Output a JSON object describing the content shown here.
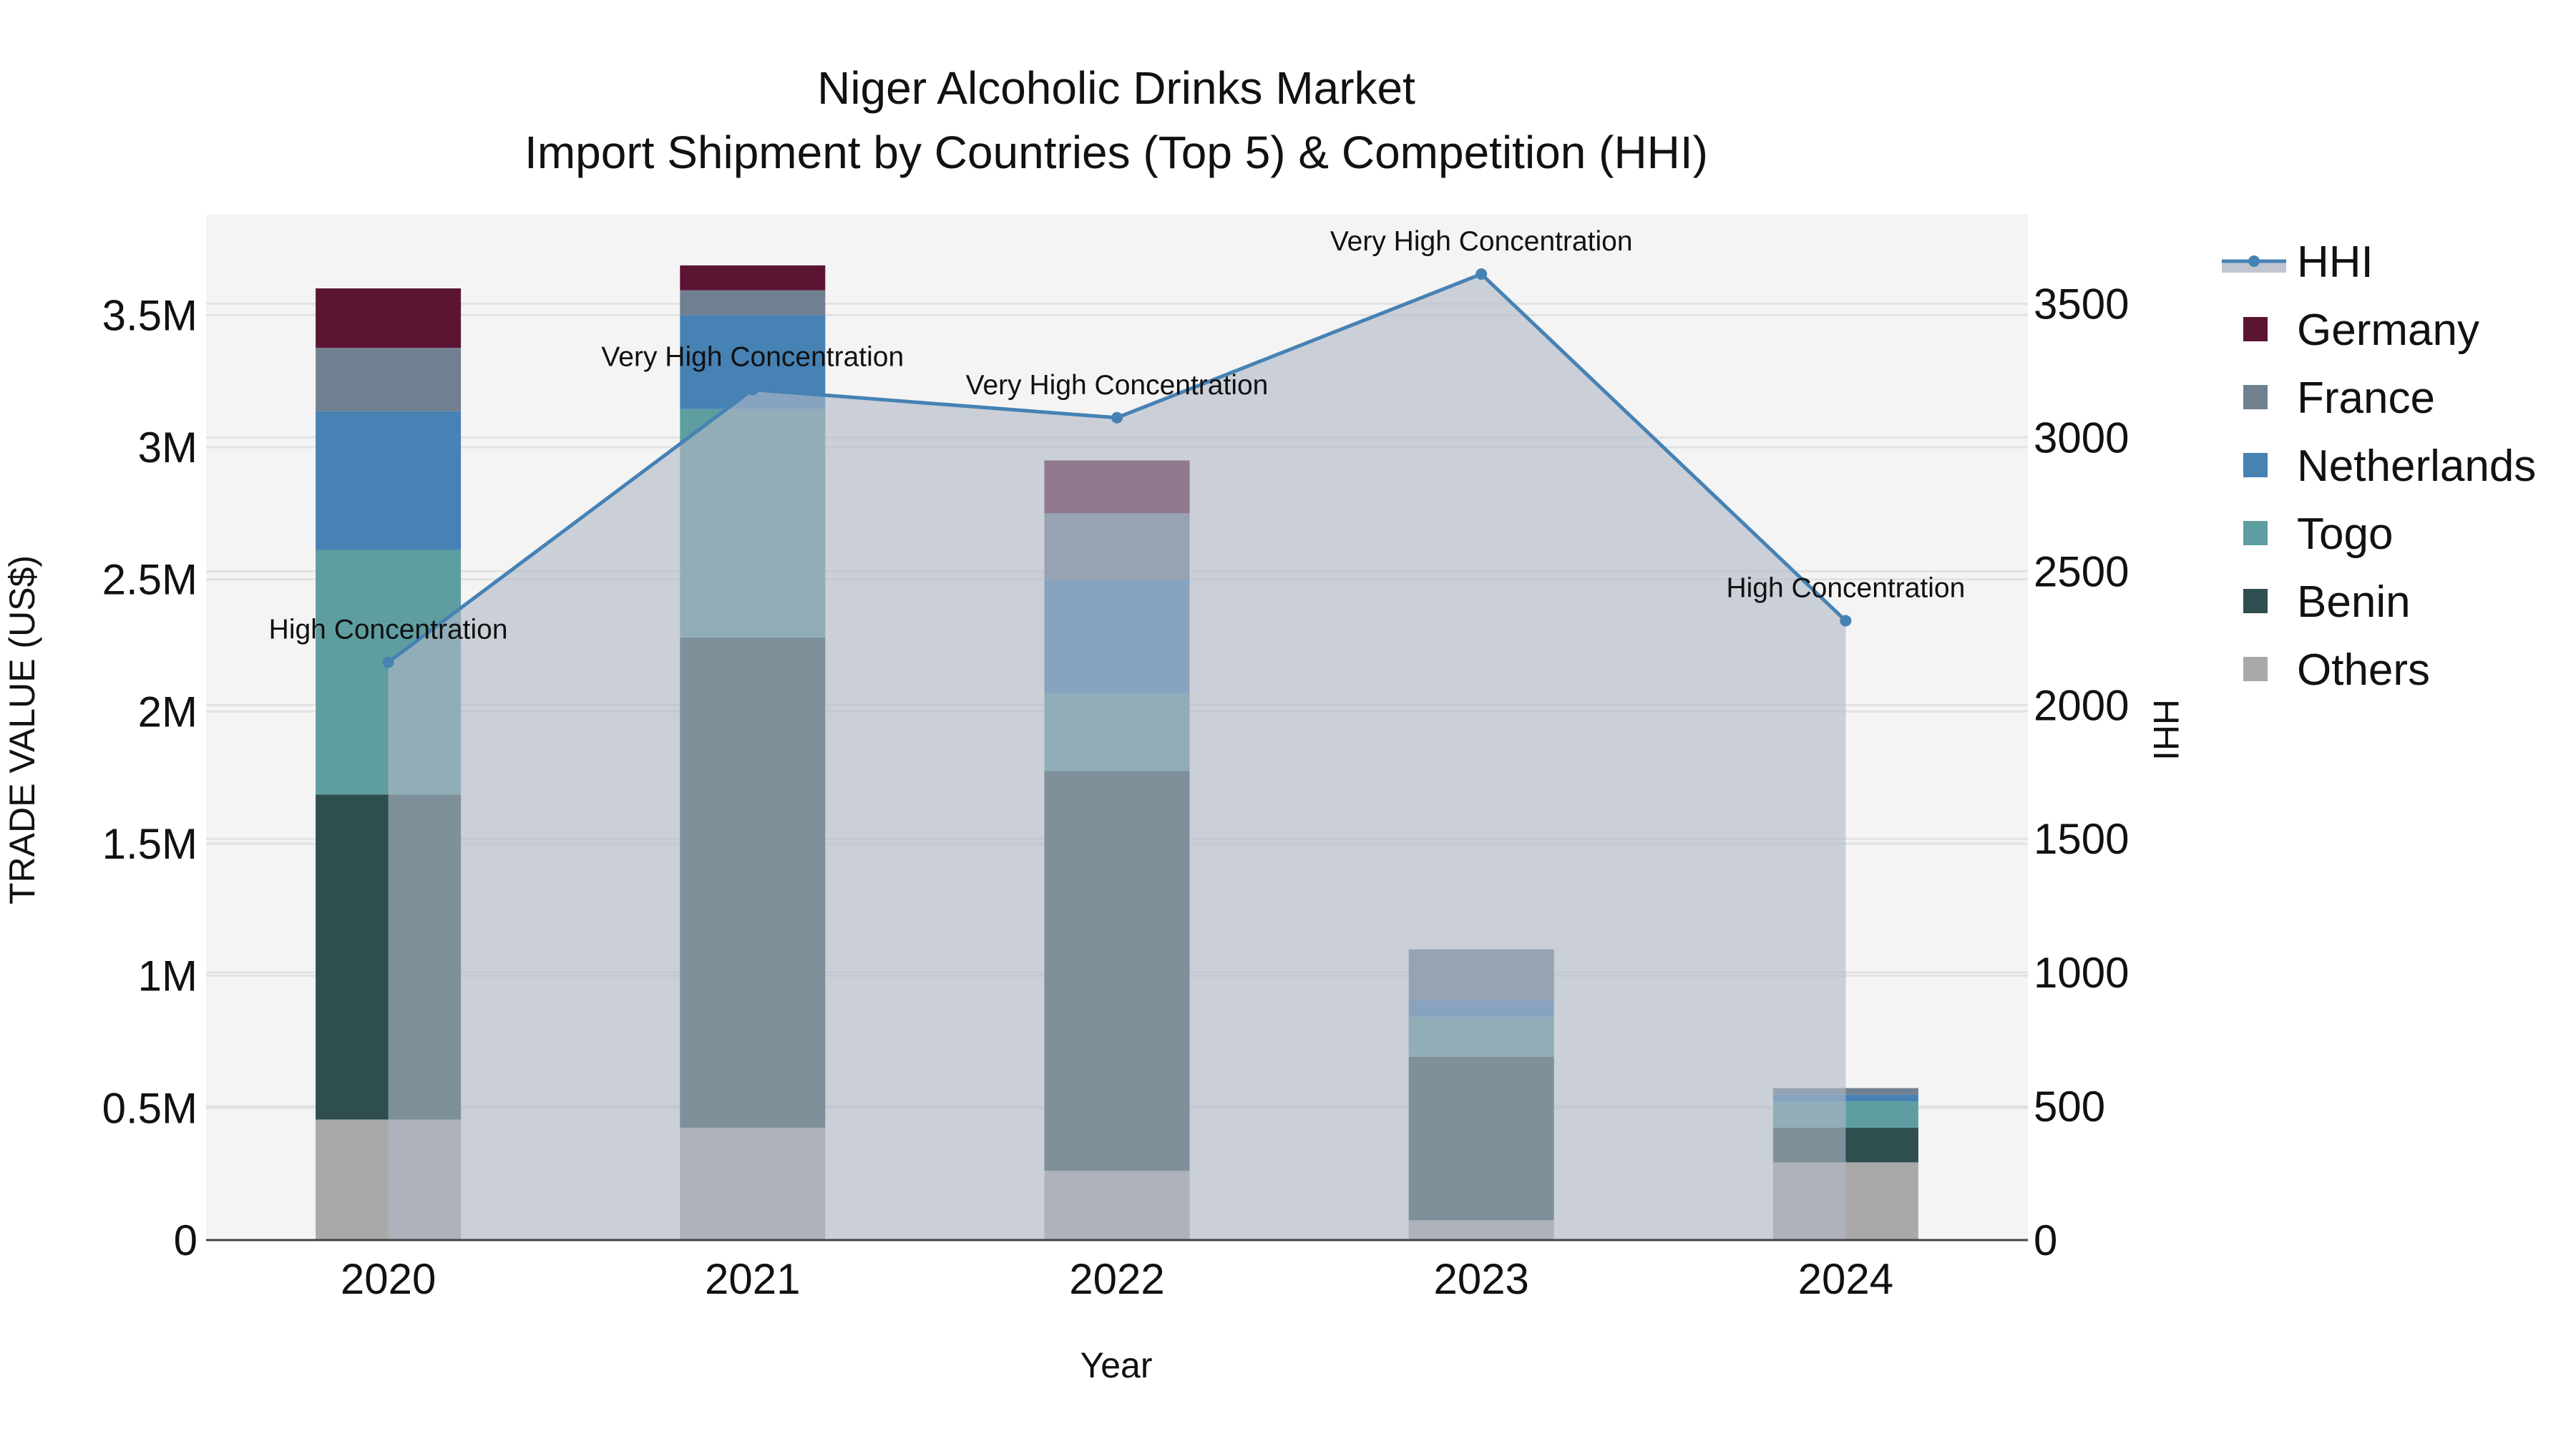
{
  "chart_data": {
    "type": "bar",
    "title": "Niger Alcoholic Drinks Market",
    "subtitle": "Import Shipment by Countries (Top 5) & Competition (HHI)",
    "xlabel": "Year",
    "ylabel": "TRADE VALUE (US$)",
    "y2label": "HHI",
    "categories": [
      "2020",
      "2021",
      "2022",
      "2023",
      "2024"
    ],
    "ylim": [
      0,
      3880000
    ],
    "y2lim": [
      0,
      3833
    ],
    "yticks": [
      0,
      500000,
      1000000,
      1500000,
      2000000,
      2500000,
      3000000,
      3500000
    ],
    "ytick_labels": [
      "0",
      "0.5M",
      "1M",
      "1.5M",
      "2M",
      "2.5M",
      "3M",
      "3.5M"
    ],
    "y2ticks": [
      0,
      500,
      1000,
      1500,
      2000,
      2500,
      3000,
      3500
    ],
    "y2tick_labels": [
      "0",
      "500",
      "1000",
      "1500",
      "2000",
      "2500",
      "3000",
      "3500"
    ],
    "grid": true,
    "legend_placement": "right",
    "series": [
      {
        "name": "Others",
        "color": "#a9a9a9",
        "values": [
          456000,
          425000,
          262000,
          75000,
          294000
        ]
      },
      {
        "name": "Benin",
        "color": "#2f4f4f",
        "values": [
          1230000,
          1855000,
          1513000,
          619000,
          131000
        ]
      },
      {
        "name": "Togo",
        "color": "#5f9ea0",
        "values": [
          925000,
          864000,
          294000,
          150000,
          100000
        ]
      },
      {
        "name": "Netherlands",
        "color": "#4682b4",
        "values": [
          525000,
          356000,
          431000,
          62000,
          25000
        ]
      },
      {
        "name": "France",
        "color": "#708090",
        "values": [
          240000,
          94000,
          250000,
          194000,
          25000
        ]
      },
      {
        "name": "Germany",
        "color": "#5c1433",
        "values": [
          225000,
          94000,
          200000,
          0,
          0
        ]
      }
    ],
    "line": {
      "name": "HHI",
      "color": "#4682b4",
      "values": [
        2160,
        3179,
        3074,
        3611,
        2315
      ],
      "annotations": [
        "High Concentration",
        "Very High Concentration",
        "Very High Concentration",
        "Very High Concentration",
        "High Concentration"
      ]
    },
    "legend_order": [
      "HHI",
      "Germany",
      "France",
      "Netherlands",
      "Togo",
      "Benin",
      "Others"
    ]
  }
}
